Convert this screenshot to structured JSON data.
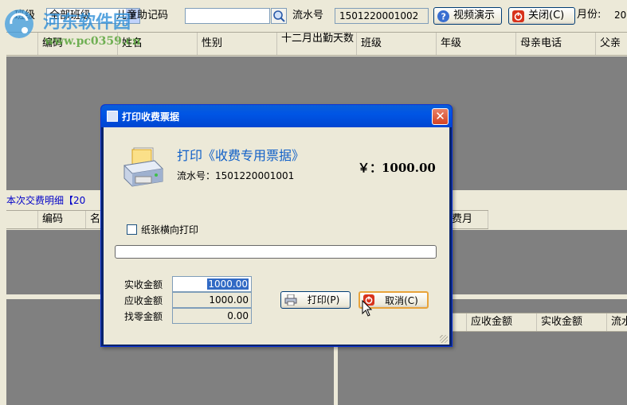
{
  "toolbar": {
    "class_label": "班级",
    "class_value": "全部班级",
    "helper_label": "儿童助记码",
    "helper_value": "",
    "serial_label": "流水号",
    "serial_value": "1501220001002",
    "video_btn": "视频演示",
    "close_btn": "关闭(C)",
    "month_label": "月份:",
    "month_value": "20"
  },
  "main_grid": {
    "columns": [
      "编码",
      "姓名",
      "性别",
      "十二月出勤天数",
      "班级",
      "年级",
      "母亲电话",
      "父亲"
    ]
  },
  "detail": {
    "title": "本次交费明细【20",
    "columns": [
      "编码",
      "名",
      "费月"
    ]
  },
  "right_grid": {
    "columns": [
      "应收金额",
      "实收金额",
      "流水"
    ]
  },
  "watermark": {
    "site_cn": "河东软件园",
    "site_url": "www.pc0359.cn"
  },
  "dialog": {
    "title": "打印收费票据",
    "heading": "打印《收费专用票据》",
    "serial_text": "流水号：1501220001001",
    "amount_text": "￥：1000.00",
    "landscape_label": "纸张横向打印",
    "landscape_checked": false,
    "progress": 0,
    "fields": {
      "actual_label": "实收金额",
      "actual_value": "1000.00",
      "due_label": "应收金额",
      "due_value": "1000.00",
      "change_label": "找零金额",
      "change_value": "0.00"
    },
    "print_btn": "打印(P)",
    "cancel_btn": "取消(C)"
  },
  "colors": {
    "titlebar": "#0055e5",
    "accent_text": "#1060c8",
    "grid_bg": "#808080"
  }
}
